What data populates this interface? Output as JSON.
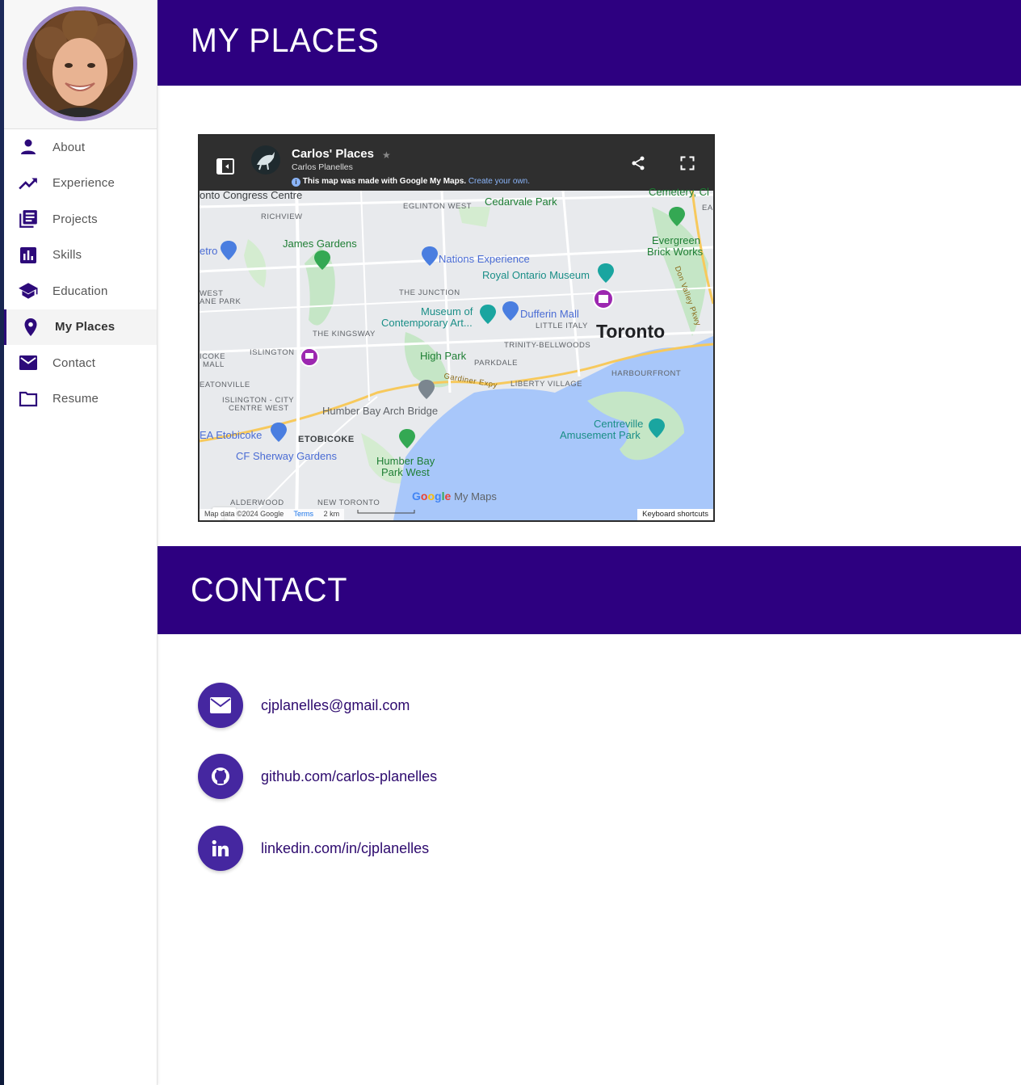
{
  "sidebar": {
    "items": [
      {
        "label": "About",
        "icon": "person-icon"
      },
      {
        "label": "Experience",
        "icon": "trending-up-icon"
      },
      {
        "label": "Projects",
        "icon": "library-books-icon"
      },
      {
        "label": "Skills",
        "icon": "bar-chart-icon"
      },
      {
        "label": "Education",
        "icon": "school-icon"
      },
      {
        "label": "My Places",
        "icon": "location-pin-icon",
        "active": true
      },
      {
        "label": "Contact",
        "icon": "mail-icon"
      },
      {
        "label": "Resume",
        "icon": "folder-icon"
      }
    ],
    "icon_color": "#2d0a7a"
  },
  "sections": {
    "places_title": "MY PLACES",
    "contact_title": "CONTACT"
  },
  "map": {
    "title": "Carlos' Places",
    "author": "Carlos Planelles",
    "note": "This map was made with Google My Maps.",
    "note_link": "Create your own.",
    "labels": {
      "congress": "onto Congress Centre",
      "richview": "RICHVIEW",
      "eglinton": "EGLINTON WEST",
      "cedarvale": "Cedarvale Park",
      "cemetery": "Cemetery, Cl",
      "ea": "EA",
      "evergreen1": "Evergreen",
      "evergreen2": "Brick Works",
      "etro": "etro",
      "james": "James Gardens",
      "nations": "Nations Experience",
      "rom": "Royal Ontario Museum",
      "donvalley": "Don Valley Pkwy",
      "west": "WEST",
      "nepark": "ANE PARK",
      "junction": "THE JUNCTION",
      "moca1": "Museum of",
      "moca2": "Contemporary Art...",
      "dufferin": "Dufferin Mall",
      "littleitaly": "LITTLE ITALY",
      "toronto": "Toronto",
      "kingsway": "THE KINGSWAY",
      "islington": "ISLINGTON",
      "icoke": "ICOKE",
      "mall": "MALL",
      "trinity": "TRINITY-BELLWOODS",
      "highpark": "High Park",
      "parkdale": "PARKDALE",
      "harbourfront": "HARBOURFRONT",
      "eatonville": "EATONVILLE",
      "gardiner": "Gardiner Expy",
      "liberty": "LIBERTY VILLAGE",
      "islcity1": "ISLINGTON - CITY",
      "islcity2": "CENTRE WEST",
      "humberbridge": "Humber Bay Arch Bridge",
      "centreville1": "Centreville",
      "centreville2": "Amusement Park",
      "ikea": "EA Etobicoke",
      "etobicoke": "ETOBICOKE",
      "sherway": "CF Sherway Gardens",
      "humberpark1": "Humber Bay",
      "humberpark2": "Park West",
      "alderwood": "ALDERWOOD",
      "newtoronto": "NEW TORONTO",
      "mymaps": "My Maps"
    },
    "zoom_in": "+",
    "zoom_out": "−",
    "attribution": "Map data ©2024 Google",
    "terms": "Terms",
    "scale": "2 km",
    "keyboard": "Keyboard shortcuts"
  },
  "contact": {
    "email": "cjplanelles@gmail.com",
    "github": "github.com/carlos-planelles",
    "linkedin": "linkedin.com/in/cjplanelles"
  },
  "colors": {
    "header_bg": "#2d0080",
    "contact_icon_bg": "#4527a0",
    "contact_text": "#2d0a6e"
  }
}
